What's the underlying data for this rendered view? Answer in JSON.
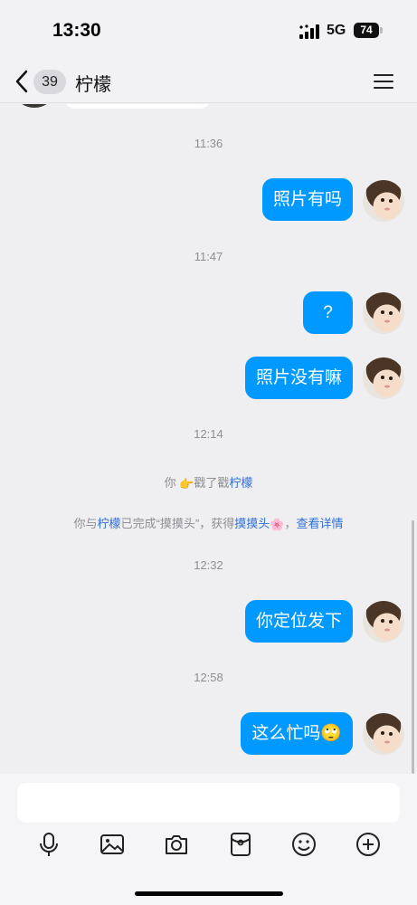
{
  "status_bar": {
    "time": "13:30",
    "network": "5G",
    "battery": "74"
  },
  "nav": {
    "unread_count": "39",
    "title": "柠檬"
  },
  "messages": {
    "t1": "11:36",
    "m1": "照片有吗",
    "t2": "11:47",
    "m2": "?",
    "m3": "照片没有嘛",
    "t3": "12:14",
    "poke": {
      "prefix": "你",
      "emoji": "👉",
      "action": "戳了戳",
      "target": "柠檬"
    },
    "achievement": {
      "part1": "你与",
      "name": "柠檬",
      "part2": "已完成“摸摸头”，获得",
      "badge": "摸摸头",
      "emoji": "🌸",
      "comma": "，",
      "details_link": "查看详情"
    },
    "t4": "12:32",
    "m4": "你定位发下",
    "t5": "12:58",
    "m5": "这么忙吗",
    "m5_emoji": "🙄"
  },
  "colors": {
    "bubble_blue": "#0099ff",
    "link_blue": "#2f6fd8",
    "timestamp_gray": "#8e8e93"
  },
  "toolbar": [
    "microphone-icon",
    "image-icon",
    "camera-icon",
    "red-packet-icon",
    "emoji-icon",
    "plus-icon"
  ]
}
